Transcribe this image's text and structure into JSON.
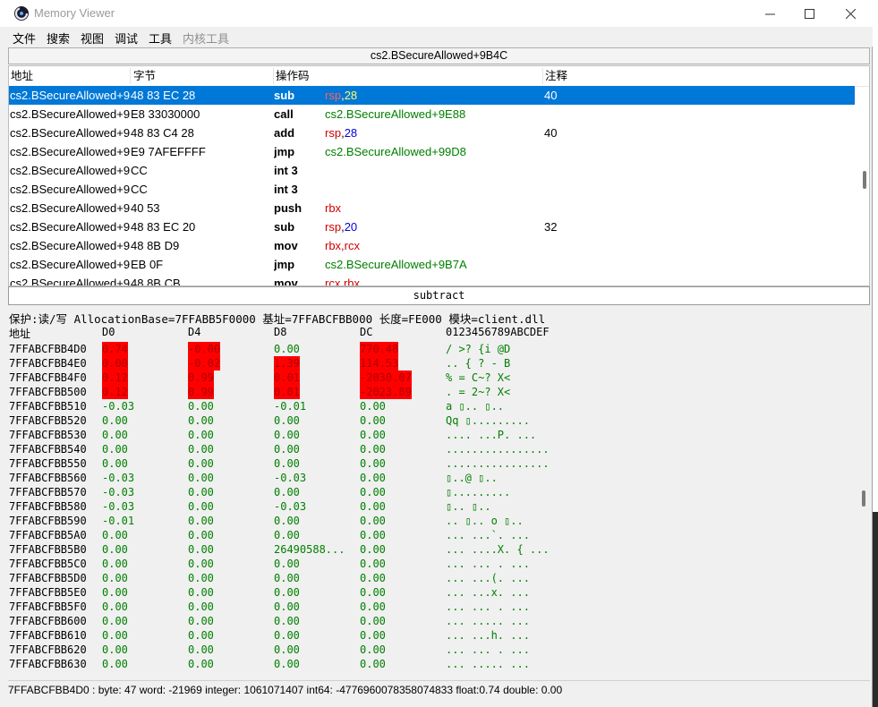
{
  "window": {
    "title": "Memory Viewer",
    "controls": {
      "minimize": "—",
      "maximize": "☐",
      "close": "✕"
    }
  },
  "menu": [
    {
      "label": "文件",
      "enabled": true
    },
    {
      "label": "搜索",
      "enabled": true
    },
    {
      "label": "视图",
      "enabled": true
    },
    {
      "label": "调试",
      "enabled": true
    },
    {
      "label": "工具",
      "enabled": true
    },
    {
      "label": "内核工具",
      "enabled": false
    }
  ],
  "disasm": {
    "current_address": "cs2.BSecureAllowed+9B4C",
    "columns": {
      "address": "地址",
      "bytes": "字节",
      "opcode": "操作码",
      "comment": "注释"
    },
    "rows": [
      {
        "address": "cs2.BSecureAllowed+9B4C",
        "bytes": "48 83 EC 28",
        "op": "sub",
        "args": [
          {
            "t": "rsp",
            "k": "reg"
          },
          {
            "t": ",",
            "k": "plain"
          },
          {
            "t": "28",
            "k": "num"
          }
        ],
        "comment": "40",
        "selected": true
      },
      {
        "address": "cs2.BSecureAllowed+9B50",
        "bytes": "E8 33030000",
        "op": "call",
        "args": [
          {
            "t": "cs2.BSecureAllowed+9E88",
            "k": "sym"
          }
        ],
        "comment": ""
      },
      {
        "address": "cs2.BSecureAllowed+9B55",
        "bytes": "48 83 C4 28",
        "op": "add",
        "args": [
          {
            "t": "rsp",
            "k": "reg"
          },
          {
            "t": ",",
            "k": "plain"
          },
          {
            "t": "28",
            "k": "num"
          }
        ],
        "comment": "40"
      },
      {
        "address": "cs2.BSecureAllowed+9B59",
        "bytes": "E9 7AFEFFFF",
        "op": "jmp",
        "args": [
          {
            "t": "cs2.BSecureAllowed+99D8",
            "k": "sym"
          }
        ],
        "comment": ""
      },
      {
        "address": "cs2.BSecureAllowed+9B5E",
        "bytes": "CC",
        "op": "int 3",
        "args": [],
        "comment": ""
      },
      {
        "address": "cs2.BSecureAllowed+9B5F",
        "bytes": "CC",
        "op": "int 3",
        "args": [],
        "comment": ""
      },
      {
        "address": "cs2.BSecureAllowed+9B60",
        "bytes": "40 53",
        "op": "push",
        "args": [
          {
            "t": "rbx",
            "k": "reg"
          }
        ],
        "comment": ""
      },
      {
        "address": "cs2.BSecureAllowed+9B62",
        "bytes": "48 83 EC 20",
        "op": "sub",
        "args": [
          {
            "t": "rsp",
            "k": "reg"
          },
          {
            "t": ",",
            "k": "plain"
          },
          {
            "t": "20",
            "k": "num"
          }
        ],
        "comment": "32"
      },
      {
        "address": "cs2.BSecureAllowed+9B66",
        "bytes": "48 8B D9",
        "op": "mov",
        "args": [
          {
            "t": "rbx,rcx",
            "k": "reg"
          }
        ],
        "comment": ""
      },
      {
        "address": "cs2.BSecureAllowed+9B69",
        "bytes": "EB 0F",
        "op": "jmp",
        "args": [
          {
            "t": "cs2.BSecureAllowed+9B7A",
            "k": "sym"
          }
        ],
        "comment": ""
      },
      {
        "address": "cs2.BSecureAllowed+9B6B",
        "bytes": "48 8B CB",
        "op": "mov",
        "args": [
          {
            "t": "rcx,rbx",
            "k": "reg"
          }
        ],
        "comment": ""
      }
    ]
  },
  "instruction_description": "subtract",
  "hex": {
    "info": "保护:读/写  AllocationBase=7FFABB5F0000 基址=7FFABCFBB000 长度=FE000 模块=client.dll",
    "header": {
      "address": "地址",
      "cols": [
        "D0",
        "D4",
        "D8",
        "DC"
      ],
      "ascii": "0123456789ABCDEF"
    },
    "rows": [
      {
        "addr": "7FFABCFBB4D0",
        "v": [
          "0.74",
          "-0.00",
          "0.00",
          "770.48"
        ],
        "chg": [
          true,
          true,
          false,
          true
        ],
        "ascii": "/ >?   {i  @D"
      },
      {
        "addr": "7FFABCFBB4E0",
        "v": [
          "0.00",
          "-0.02",
          "1.39",
          "114.53"
        ],
        "chg": [
          true,
          true,
          true,
          true
        ],
        "ascii": " ..  {     ? - B"
      },
      {
        "addr": "7FFABCFBB4F0",
        "v": [
          "0.12",
          "0.99",
          "0.01",
          "-2030.07"
        ],
        "chg": [
          true,
          true,
          true,
          true
        ],
        "ascii": " % = C~?  X<"
      },
      {
        "addr": "7FFABCFBB500",
        "v": [
          "0.12",
          "0.99",
          "0.01",
          "-2023.89"
        ],
        "chg": [
          true,
          true,
          true,
          true
        ],
        "ascii": "  . = 2~?  X<"
      },
      {
        "addr": "7FFABCFBB510",
        "v": [
          "-0.03",
          "0.00",
          "-0.01",
          "0.00"
        ],
        "ascii": " a   ▯..     ▯.."
      },
      {
        "addr": "7FFABCFBB520",
        "v": [
          "0.00",
          "0.00",
          "0.00",
          "0.00"
        ],
        "ascii": " Qq  ▯........."
      },
      {
        "addr": "7FFABCFBB530",
        "v": [
          "0.00",
          "0.00",
          "0.00",
          "0.00"
        ],
        "ascii": ".... ...P.   ..."
      },
      {
        "addr": "7FFABCFBB540",
        "v": [
          "0.00",
          "0.00",
          "0.00",
          "0.00"
        ],
        "ascii": "................"
      },
      {
        "addr": "7FFABCFBB550",
        "v": [
          "0.00",
          "0.00",
          "0.00",
          "0.00"
        ],
        "ascii": "................"
      },
      {
        "addr": "7FFABCFBB560",
        "v": [
          "-0.03",
          "0.00",
          "-0.03",
          "0.00"
        ],
        "ascii": "     ▯..@    ▯.."
      },
      {
        "addr": "7FFABCFBB570",
        "v": [
          "-0.03",
          "0.00",
          "0.00",
          "0.00"
        ],
        "ascii": "     ▯........."
      },
      {
        "addr": "7FFABCFBB580",
        "v": [
          "-0.03",
          "0.00",
          "-0.03",
          "0.00"
        ],
        "ascii": "     ▯..     ▯.."
      },
      {
        "addr": "7FFABCFBB590",
        "v": [
          "-0.01",
          "0.00",
          "0.00",
          "0.00"
        ],
        "ascii": "..   ▯..  o  ▯.."
      },
      {
        "addr": "7FFABCFBB5A0",
        "v": [
          "0.00",
          "0.00",
          "0.00",
          "0.00"
        ],
        "ascii": " ... ...`.   ..."
      },
      {
        "addr": "7FFABCFBB5B0",
        "v": [
          "0.00",
          "0.00",
          "26490588...",
          "0.00"
        ],
        "ascii": " ... ....X. { ..."
      },
      {
        "addr": "7FFABCFBB5C0",
        "v": [
          "0.00",
          "0.00",
          "0.00",
          "0.00"
        ],
        "ascii": " ... ... .   ..."
      },
      {
        "addr": "7FFABCFBB5D0",
        "v": [
          "0.00",
          "0.00",
          "0.00",
          "0.00"
        ],
        "ascii": " ... ...(.   ..."
      },
      {
        "addr": "7FFABCFBB5E0",
        "v": [
          "0.00",
          "0.00",
          "0.00",
          "0.00"
        ],
        "ascii": " ... ...x.   ..."
      },
      {
        "addr": "7FFABCFBB5F0",
        "v": [
          "0.00",
          "0.00",
          "0.00",
          "0.00"
        ],
        "ascii": " ... ... .   ..."
      },
      {
        "addr": "7FFABCFBB600",
        "v": [
          "0.00",
          "0.00",
          "0.00",
          "0.00"
        ],
        "ascii": " ... .....   ..."
      },
      {
        "addr": "7FFABCFBB610",
        "v": [
          "0.00",
          "0.00",
          "0.00",
          "0.00"
        ],
        "ascii": " ... ...h.   ..."
      },
      {
        "addr": "7FFABCFBB620",
        "v": [
          "0.00",
          "0.00",
          "0.00",
          "0.00"
        ],
        "ascii": " ... ... .   ..."
      },
      {
        "addr": "7FFABCFBB630",
        "v": [
          "0.00",
          "0.00",
          "0.00",
          "0.00"
        ],
        "ascii": " ... .....   ..."
      }
    ]
  },
  "status": "7FFABCFBB4D0 : byte: 47 word: -21969 integer: 1061071407 int64: -4776960078358074833 float:0.74 double: 0.00",
  "colors": {
    "selection": "#0078d7",
    "register": "#d00000",
    "number": "#0000e0",
    "symbol": "#008000",
    "changed": "#ff0000"
  }
}
